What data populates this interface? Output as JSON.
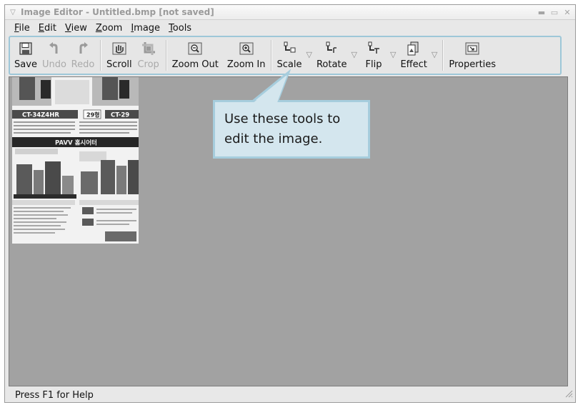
{
  "window": {
    "title": "Image Editor - Untitled.bmp [not saved]",
    "controls": [
      "minimize-icon",
      "maximize-icon",
      "close-icon"
    ]
  },
  "menu": {
    "items": [
      {
        "mnemonic": "F",
        "rest": "ile"
      },
      {
        "mnemonic": "E",
        "rest": "dit"
      },
      {
        "mnemonic": "V",
        "rest": "iew"
      },
      {
        "mnemonic": "Z",
        "rest": "oom"
      },
      {
        "mnemonic": "I",
        "rest": "mage"
      },
      {
        "mnemonic": "T",
        "rest": "ools"
      }
    ]
  },
  "toolbar": {
    "save": "Save",
    "undo": "Undo",
    "redo": "Redo",
    "scroll": "Scroll",
    "crop": "Crop",
    "zoom_out": "Zoom Out",
    "zoom_in": "Zoom In",
    "scale": "Scale",
    "rotate": "Rotate",
    "flip": "Flip",
    "effect": "Effect",
    "properties": "Properties",
    "dropdown_glyph": "▽"
  },
  "callout": {
    "text": "Use these tools to\nedit the image."
  },
  "image": {
    "model_left": "CT-34Z4HR",
    "model_right": "CT-29",
    "section": "29형",
    "banner": "PAVV 홈시어터"
  },
  "status": {
    "text": "Press F1 for Help"
  },
  "colors": {
    "callout_fill": "#d4e6ee",
    "callout_border": "#a6cddd",
    "toolbar_highlight": "#9ec7d8",
    "canvas_bg": "#a2a2a2"
  }
}
